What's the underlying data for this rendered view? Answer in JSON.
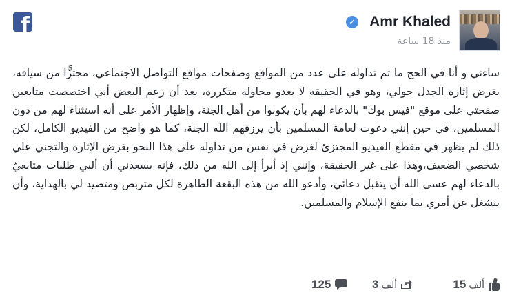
{
  "author": {
    "name": "Amr Khaled",
    "verified_glyph": "✓",
    "time": "منذ 18 ساعة"
  },
  "brand": {
    "logo_letter": "f",
    "color": "#3b5998"
  },
  "post": {
    "text": "ساءني و أنا في الحج ما تم تداوله على عدد من المواقع وصفحات مواقع التواصل الاجتماعي، مجتزًّا من سياقه، بغرض إثارة الجدل حولي، وهو في الحقيقة لا يعدو محاولة متكررة، بعد أن زعم البعض أني اختصصت متابعين صفحتي على موقع \"فيس بوك\" بالدعاء لهم بأن يكونوا من أهل الجنة، وإظهار الأمر على أنه استثناء لهم من دون المسلمين، في حين إنني دعوت لعامة المسلمين بأن يرزقهم الله الجنة، كما هو واضح من الفيديو الكامل، لكن ذلك لم يظهر في مقطع الفيديو المجتزئ لغرض في نفس من تداوله على هذا النحو بغرض الإثارة والتجني علي شخصي الضعيف،وهذا على غير الحقيقة، وإنني إذ أبرأ إلى الله من ذلك، فإنه يسعدني أن ألبي طلبات متابعيّ بالدعاء لهم عسى الله أن يتقبل دعائي، وأدعو الله من هذه البقعة الطاهرة لكل متربص ومتصيد لي بالهداية، وأن ينشغل عن أمري بما ينفع الإسلام والمسلمين."
  },
  "stats": {
    "likes_count": "15",
    "likes_unit": "ألف",
    "likes_icon": "like-icon",
    "shares_count": "3",
    "shares_unit": "ألف",
    "shares_icon": "share-icon",
    "comments_count": "125",
    "comments_icon": "comment-icon"
  }
}
